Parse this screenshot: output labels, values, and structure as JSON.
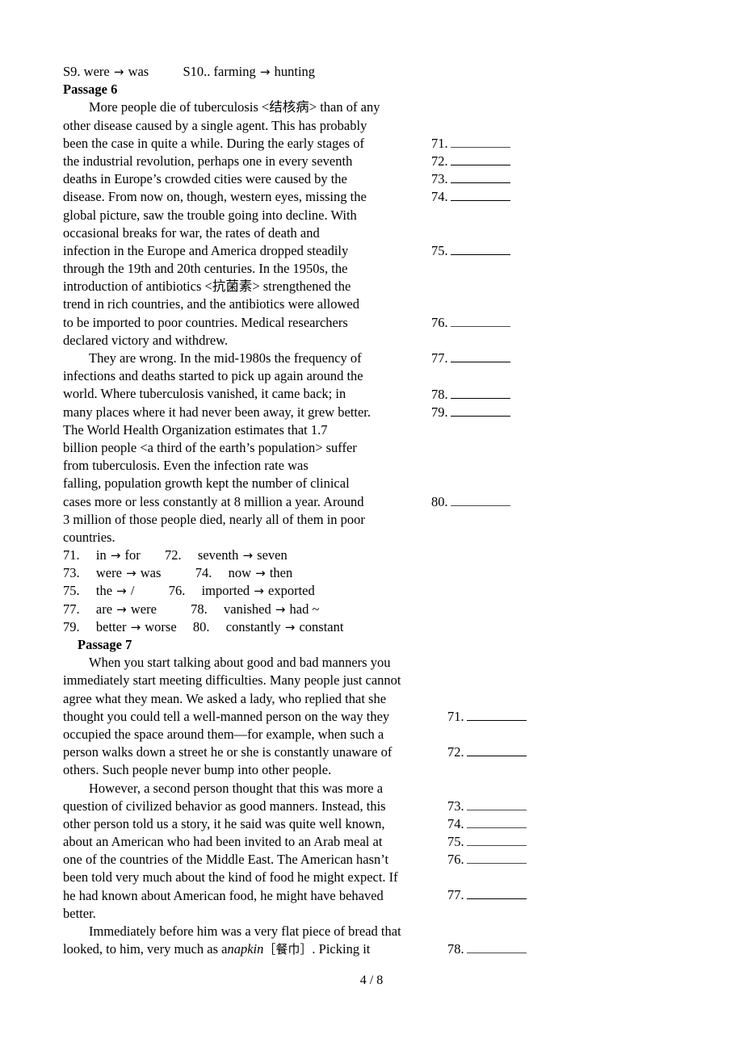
{
  "document": {
    "footer": {
      "page": "4",
      "separator": "/",
      "total": "8"
    }
  },
  "corrections_prev": {
    "s9": "S9. were",
    "s9_to": "was",
    "s10": "S10.. farming",
    "s10_to": "hunting",
    "arrow": "→"
  },
  "passage6": {
    "heading": "Passage 6",
    "lines": [
      "More people die of tuberculosis <结核病> than of any",
      "other disease caused by a single agent. This has probably",
      "been the case in quite a while. During the early stages of",
      "the industrial revolution, perhaps one in every seventh",
      "deaths in Europe’s crowded cities were caused by the",
      "disease. From now on, though, western eyes, missing the",
      "global picture, saw the trouble going into decline. With",
      "occasional breaks for war, the rates of death and",
      "infection in the Europe and America dropped steadily",
      "through the 19th and 20th centuries. In the 1950s, the",
      "introduction of antibiotics <抗菌素> strengthened the",
      "trend in rich countries, and the antibiotics were allowed",
      "to be imported to poor countries. Medical researchers",
      "declared victory and withdrew.",
      "They are wrong. In the mid-1980s the frequency of",
      "infections and deaths started to pick up again around the",
      "world. Where tuberculosis vanished, it came back; in",
      "many places where it had never been away, it grew better.",
      "The World Health Organization estimates that 1.7",
      "billion people <a third of the earth’s population> suffer",
      "from tuberculosis. Even the infection rate was",
      "falling, population growth kept the number of clinical",
      "cases more or less constantly at 8 million a year. Around",
      "3 million of those people died, nearly all of them in poor",
      "countries."
    ],
    "blanks": [
      "71.",
      "72.",
      "73.",
      "74.",
      "75.",
      "76.",
      "77.",
      "78.",
      "79.",
      "80."
    ],
    "answers": [
      {
        "num": "71.",
        "from": "in",
        "to": "for"
      },
      {
        "num": "72.",
        "from": "seventh",
        "to": "seven"
      },
      {
        "num": "73.",
        "from": "were",
        "to": "was"
      },
      {
        "num": "74.",
        "from": "now",
        "to": "then"
      },
      {
        "num": "75.",
        "from": "the",
        "to": "/"
      },
      {
        "num": "76.",
        "from": "imported",
        "to": "exported"
      },
      {
        "num": "77.",
        "from": "are",
        "to": "were"
      },
      {
        "num": "78.",
        "from": "vanished",
        "to": "had ~"
      },
      {
        "num": "79.",
        "from": "better",
        "to": "worse"
      },
      {
        "num": "80.",
        "from": "constantly",
        "to": "constant"
      }
    ]
  },
  "passage7": {
    "heading": "Passage 7",
    "lines": [
      "When you start talking about good and bad manners you",
      "immediately start meeting difficulties. Many people just cannot",
      "agree what they mean. We asked a lady, who replied that she",
      "thought you could tell a well-manned person on the way they",
      "occupied the space around them—for example, when such a",
      "person walks down a street he or she is constantly unaware of",
      "others. Such people never bump into other people.",
      "However, a second person thought that this was more a",
      "question of civilized behavior as good manners. Instead, this",
      "other person told us a story, it he said was quite well known,",
      "about an American who had been invited to an Arab meal at",
      "one of the countries of the Middle East. The American hasn’t",
      "been told very much about the kind of food he might expect. If",
      "he had known about American food, he might have behaved",
      "better.",
      "Immediately before him was a very flat piece of bread that"
    ],
    "last_line": {
      "pre": "looked, to him, very much as a ",
      "italic": "napkin",
      "bracket": "［餐巾］",
      "post": ". Picking it"
    },
    "blanks": [
      "71.",
      "72.",
      "73.",
      "74.",
      "75.",
      "76.",
      "77.",
      "78."
    ]
  }
}
